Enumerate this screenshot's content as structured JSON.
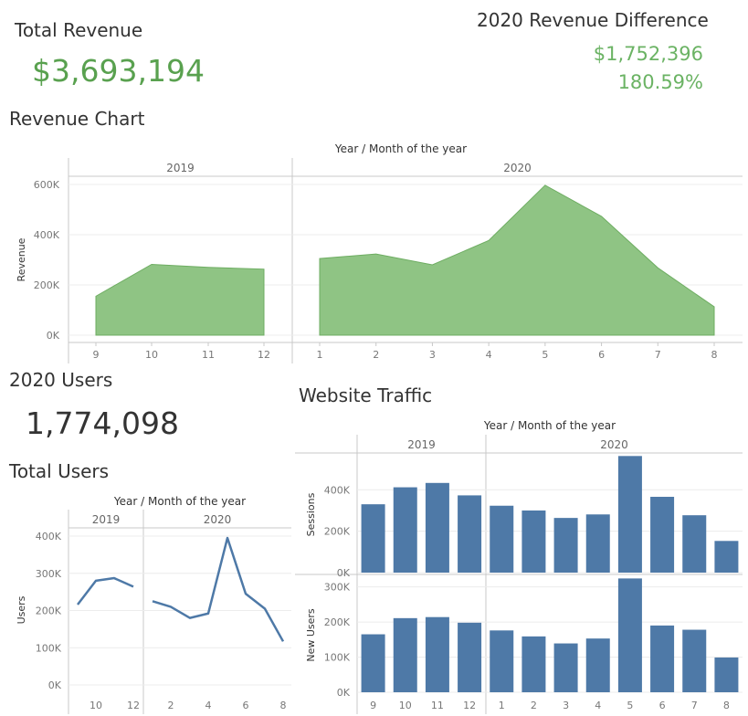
{
  "total_revenue": {
    "title": "Total Revenue",
    "value": "$3,693,194"
  },
  "revenue_difference": {
    "title": "2020 Revenue Difference",
    "amount": "$1,752,396",
    "percent": "180.59%"
  },
  "users_2020": {
    "title": "2020 Users",
    "value": "1,774,098"
  },
  "total_users_title": "Total Users",
  "colors": {
    "green_area": "#8fc484",
    "green_stroke": "#6ead62",
    "green_text": "#59a14f",
    "blue": "#4e79a7",
    "grid": "#ececec",
    "rule": "#c8c8c8"
  },
  "chart_data": [
    {
      "type": "area",
      "title": "Revenue Chart",
      "header": "Year / Month of the year",
      "ylabel": "Revenue",
      "ylim": [
        0,
        600000
      ],
      "yticks": [
        0,
        200000,
        400000,
        600000
      ],
      "ytick_labels": [
        "0K",
        "200K",
        "400K",
        "600K"
      ],
      "groups": [
        {
          "name": "2019",
          "x": [
            "9",
            "10",
            "11",
            "12"
          ],
          "values": [
            155000,
            282000,
            270000,
            263000
          ]
        },
        {
          "name": "2020",
          "x": [
            "1",
            "2",
            "3",
            "4",
            "5",
            "6",
            "7",
            "8"
          ],
          "values": [
            305000,
            323000,
            280000,
            377000,
            597000,
            473000,
            268000,
            113000
          ]
        }
      ]
    },
    {
      "type": "line",
      "title": "Total Users",
      "header": "Year / Month of the year",
      "ylabel": "Users",
      "ylim": [
        0,
        400000
      ],
      "yticks": [
        0,
        100000,
        200000,
        300000,
        400000
      ],
      "ytick_labels": [
        "0K",
        "100K",
        "200K",
        "300K",
        "400K"
      ],
      "groups": [
        {
          "name": "2019",
          "x": [
            "9",
            "10",
            "11",
            "12"
          ],
          "x_labels": [
            "",
            "10",
            "",
            "12"
          ],
          "values": [
            216000,
            280000,
            287000,
            264000
          ]
        },
        {
          "name": "2020",
          "x": [
            "1",
            "2",
            "3",
            "4",
            "5",
            "6",
            "7",
            "8"
          ],
          "x_labels": [
            "",
            "2",
            "",
            "4",
            "",
            "6",
            "",
            "8"
          ],
          "values": [
            225000,
            210000,
            180000,
            192000,
            395000,
            245000,
            205000,
            117000
          ]
        }
      ]
    },
    {
      "type": "bar",
      "title": "Website Traffic",
      "header": "Year / Month of the year",
      "groups": [
        {
          "name": "2019",
          "x": [
            "9",
            "10",
            "11",
            "12"
          ]
        },
        {
          "name": "2020",
          "x": [
            "1",
            "2",
            "3",
            "4",
            "5",
            "6",
            "7",
            "8"
          ]
        }
      ],
      "panels": [
        {
          "ylabel": "Sessions",
          "ylim": [
            0,
            560000
          ],
          "yticks": [
            0,
            200000,
            400000
          ],
          "ytick_labels": [
            "0K",
            "200K",
            "400K"
          ],
          "values": [
            330000,
            412000,
            433000,
            373000,
            323000,
            300000,
            264000,
            281000,
            563000,
            366000,
            277000,
            153000
          ]
        },
        {
          "ylabel": "New Users",
          "ylim": [
            0,
            325000
          ],
          "yticks": [
            0,
            100000,
            200000,
            300000
          ],
          "ytick_labels": [
            "0K",
            "100K",
            "200K",
            "300K"
          ],
          "values": [
            165000,
            211000,
            214000,
            198000,
            176000,
            159000,
            139000,
            153000,
            324000,
            190000,
            178000,
            99000
          ]
        }
      ]
    }
  ]
}
